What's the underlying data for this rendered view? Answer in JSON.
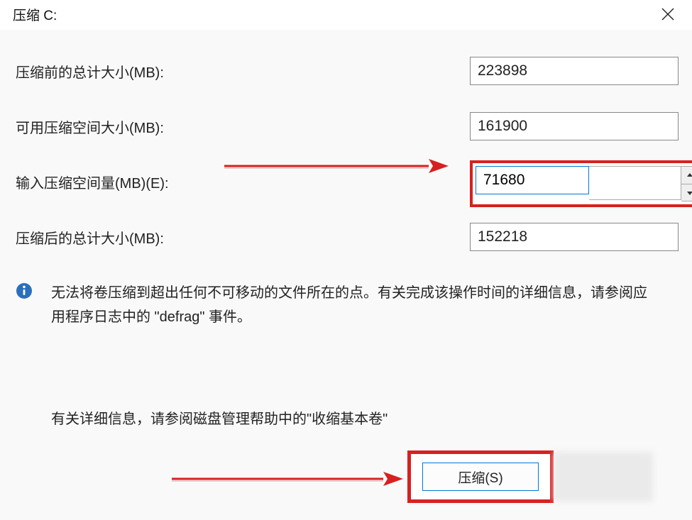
{
  "window": {
    "title": "压缩 C:"
  },
  "fields": {
    "total_before": {
      "label": "压缩前的总计大小(MB):",
      "value": "223898"
    },
    "available": {
      "label": "可用压缩空间大小(MB):",
      "value": "161900"
    },
    "shrink_amount": {
      "label": "输入压缩空间量(MB)(E):",
      "value": "71680"
    },
    "total_after": {
      "label": "压缩后的总计大小(MB):",
      "value": "152218"
    }
  },
  "info": {
    "text": "无法将卷压缩到超出任何不可移动的文件所在的点。有关完成该操作时间的详细信息，请参阅应用程序日志中的 \"defrag\" 事件。"
  },
  "help": {
    "text": "有关详细信息，请参阅磁盘管理帮助中的\"收缩基本卷\""
  },
  "buttons": {
    "shrink": "压缩(S)"
  },
  "annotations": {
    "highlight_color": "#d82020"
  }
}
